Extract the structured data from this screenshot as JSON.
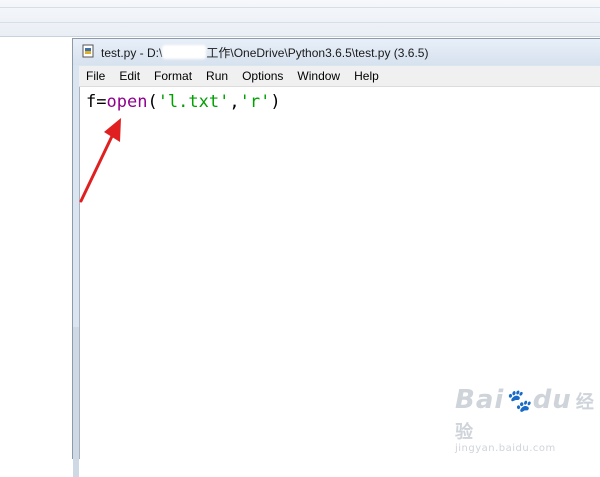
{
  "window": {
    "title": "test.py - D:\\",
    "title_rest": "工作\\OneDrive\\Python3.6.5\\test.py (3.6.5)"
  },
  "menu": [
    "File",
    "Edit",
    "Format",
    "Run",
    "Options",
    "Window",
    "Help"
  ],
  "editor": {
    "code": {
      "var": "f=",
      "func": "open",
      "paren_open": "(",
      "arg1": "'l.txt'",
      "comma": ",",
      "arg2": "'r'",
      "paren_close": ")"
    }
  },
  "annotation": {
    "arrow_color": "#e02020"
  },
  "watermark": {
    "brand": "Bai",
    "brand2": "du",
    "brand_cn": "经验",
    "url": "jingyan.baidu.com"
  },
  "colors": {
    "builtin": "#900090",
    "string": "#00a000",
    "titlebar": "#dbe5f1"
  }
}
